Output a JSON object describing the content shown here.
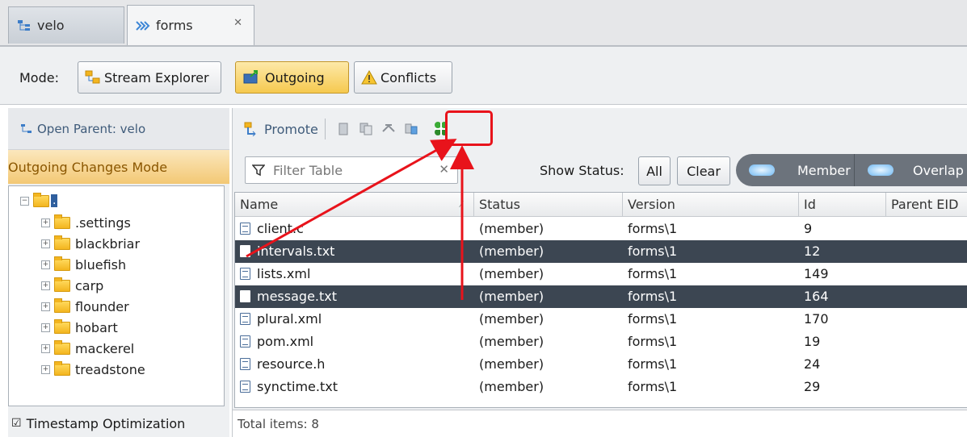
{
  "tabs": [
    {
      "label": "velo",
      "active": false
    },
    {
      "label": "forms",
      "active": true
    }
  ],
  "mode": {
    "label": "Mode:",
    "buttons": [
      {
        "label": "Stream Explorer",
        "selected": false
      },
      {
        "label": "Outgoing",
        "selected": true
      },
      {
        "label": "Conflicts",
        "selected": false
      }
    ]
  },
  "left": {
    "open_parent": "Open Parent:  velo",
    "mode_banner": "Outgoing Changes Mode",
    "tree_root": ".",
    "folders": [
      ".settings",
      "blackbriar",
      "bluefish",
      "carp",
      "flounder",
      "hobart",
      "mackerel",
      "treadstone"
    ],
    "timestamp_label": "Timestamp Optimization",
    "timestamp_checked": true
  },
  "toolbar": {
    "promote_label": "Promote"
  },
  "filter": {
    "placeholder": "Filter Table",
    "show_status_label": "Show Status:",
    "all_label": "All",
    "clear_label": "Clear",
    "member_label": "Member",
    "overlap_label": "Overlap"
  },
  "table": {
    "headers": [
      "Name",
      "Status",
      "Version",
      "Id",
      "Parent EID"
    ],
    "rows": [
      {
        "name": "client.c",
        "status": "(member)",
        "version": "forms\\1",
        "id": "9",
        "selected": false
      },
      {
        "name": "intervals.txt",
        "status": "(member)",
        "version": "forms\\1",
        "id": "12",
        "selected": true
      },
      {
        "name": "lists.xml",
        "status": "(member)",
        "version": "forms\\1",
        "id": "149",
        "selected": false
      },
      {
        "name": "message.txt",
        "status": "(member)",
        "version": "forms\\1",
        "id": "164",
        "selected": true
      },
      {
        "name": "plural.xml",
        "status": "(member)",
        "version": "forms\\1",
        "id": "170",
        "selected": false
      },
      {
        "name": "pom.xml",
        "status": "(member)",
        "version": "forms\\1",
        "id": "19",
        "selected": false
      },
      {
        "name": "resource.h",
        "status": "(member)",
        "version": "forms\\1",
        "id": "24",
        "selected": false
      },
      {
        "name": "synctime.txt",
        "status": "(member)",
        "version": "forms\\1",
        "id": "29",
        "selected": false
      }
    ],
    "total_label": "Total items: 8"
  },
  "colors": {
    "accent_selection": "#3c4652",
    "mode_banner": "#f3c874",
    "annotation_red": "#e8131b"
  }
}
